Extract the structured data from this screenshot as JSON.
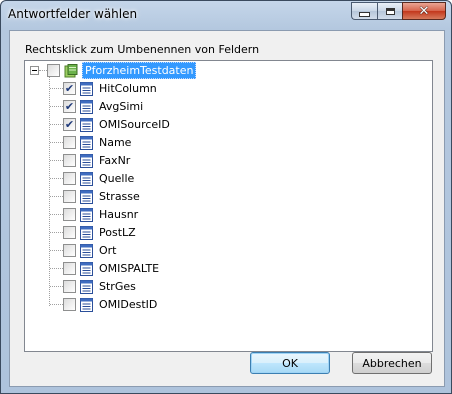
{
  "window": {
    "title": "Antwortfelder wählen"
  },
  "caption_buttons": {
    "minimize": "minimize",
    "maximize": "maximize",
    "close": "close"
  },
  "instruction": "Rechtsklick zum Umbenennen von Feldern",
  "tree": {
    "root": {
      "label": "PforzheimTestdaten",
      "checked": false,
      "expanded": true
    },
    "items": [
      {
        "label": "HitColumn",
        "checked": true
      },
      {
        "label": "AvgSimi",
        "checked": true
      },
      {
        "label": "OMISourceID",
        "checked": true
      },
      {
        "label": "Name",
        "checked": false
      },
      {
        "label": "FaxNr",
        "checked": false
      },
      {
        "label": "Quelle",
        "checked": false
      },
      {
        "label": "Strasse",
        "checked": false
      },
      {
        "label": "Hausnr",
        "checked": false
      },
      {
        "label": "PostLZ",
        "checked": false
      },
      {
        "label": "Ort",
        "checked": false
      },
      {
        "label": "OMISPALTE",
        "checked": false
      },
      {
        "label": "StrGes",
        "checked": false
      },
      {
        "label": "OMIDestID",
        "checked": false
      }
    ]
  },
  "buttons": {
    "ok": "OK",
    "cancel": "Abbrechen"
  }
}
